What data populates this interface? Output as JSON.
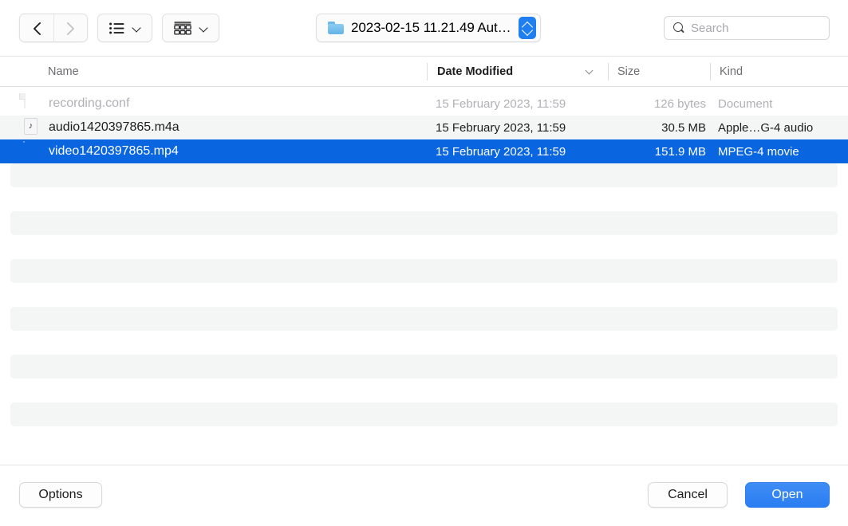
{
  "toolbar": {
    "nav": {
      "back_icon": "chevron-left-icon",
      "back_enabled": true,
      "forward_icon": "chevron-right-icon",
      "forward_enabled": false
    },
    "view_list": {
      "icon": "list-view-icon",
      "chevron": "chevron-down-icon"
    },
    "view_group": {
      "icon": "arrange-grid-icon",
      "chevron": "chevron-down-icon"
    },
    "path": {
      "folder_icon": "blue-folder-icon",
      "label": "2023-02-15 11.21.49 Aut…",
      "stepper_icon": "up-down-chevron-icon"
    },
    "search": {
      "icon": "search-icon",
      "placeholder": "Search",
      "value": ""
    }
  },
  "columns": [
    {
      "key": "name",
      "label": "Name",
      "sorted": false
    },
    {
      "key": "date",
      "label": "Date Modified",
      "sorted": true,
      "sort_icon": "chevron-down-icon"
    },
    {
      "key": "size",
      "label": "Size",
      "sorted": false
    },
    {
      "key": "kind",
      "label": "Kind",
      "sorted": false
    }
  ],
  "files": [
    {
      "name": "recording.conf",
      "date": "15 February 2023, 11:59",
      "size": "126 bytes",
      "kind": "Document",
      "icon": "document-file-icon",
      "state": "disabled",
      "zebra": false
    },
    {
      "name": "audio1420397865.m4a",
      "date": "15 February 2023, 11:59",
      "size": "30.5 MB",
      "kind": "Apple…G-4 audio",
      "icon": "audio-file-icon",
      "state": "normal",
      "zebra": true
    },
    {
      "name": "video1420397865.mp4",
      "date": "15 February 2023, 11:59",
      "size": "151.9 MB",
      "kind": "MPEG-4 movie",
      "icon": "video-file-icon",
      "state": "selected",
      "zebra": false
    }
  ],
  "empty_stripes": 6,
  "buttons": {
    "options": "Options",
    "cancel": "Cancel",
    "open": "Open"
  },
  "colors": {
    "selection_blue": "#0a66e0",
    "default_button_blue": "#2a7ef2",
    "zebra_grey": "#f4f5f5",
    "folder_blue": "#63b4e8",
    "disabled_text": "#b0b0b5",
    "secondary_text": "#6d6d72"
  }
}
